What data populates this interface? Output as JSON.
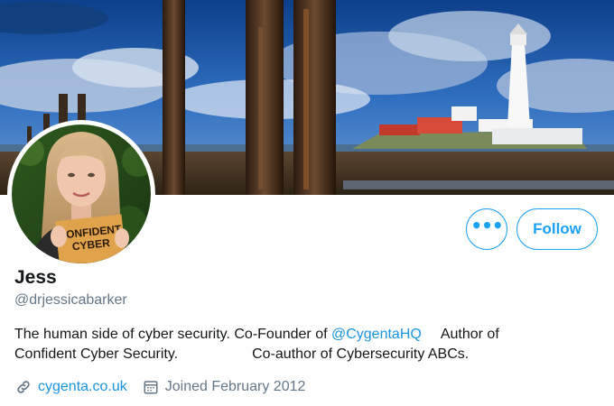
{
  "profile": {
    "name": "Jess",
    "handle": "@drjessicabarker",
    "bio": {
      "part1": "The human side of cyber security.  Co-Founder of ",
      "mention": "@CygentaHQ",
      "part2": "Author of",
      "part3": "Confident Cyber Security.",
      "part4": "Co-author of Cybersecurity ABCs."
    },
    "website": "cygenta.co.uk",
    "joined": "Joined February 2012",
    "avatar_book_text": [
      "CONFIDENT",
      "CYBER"
    ]
  },
  "actions": {
    "more_label": "•••",
    "follow_label": "Follow"
  },
  "colors": {
    "accent": "#1da1f2",
    "link": "#1b95e0",
    "secondary_text": "#657786",
    "primary_text": "#14171a"
  },
  "icons": {
    "more": "more-dots-icon",
    "website": "link-icon",
    "joined": "calendar-icon"
  }
}
